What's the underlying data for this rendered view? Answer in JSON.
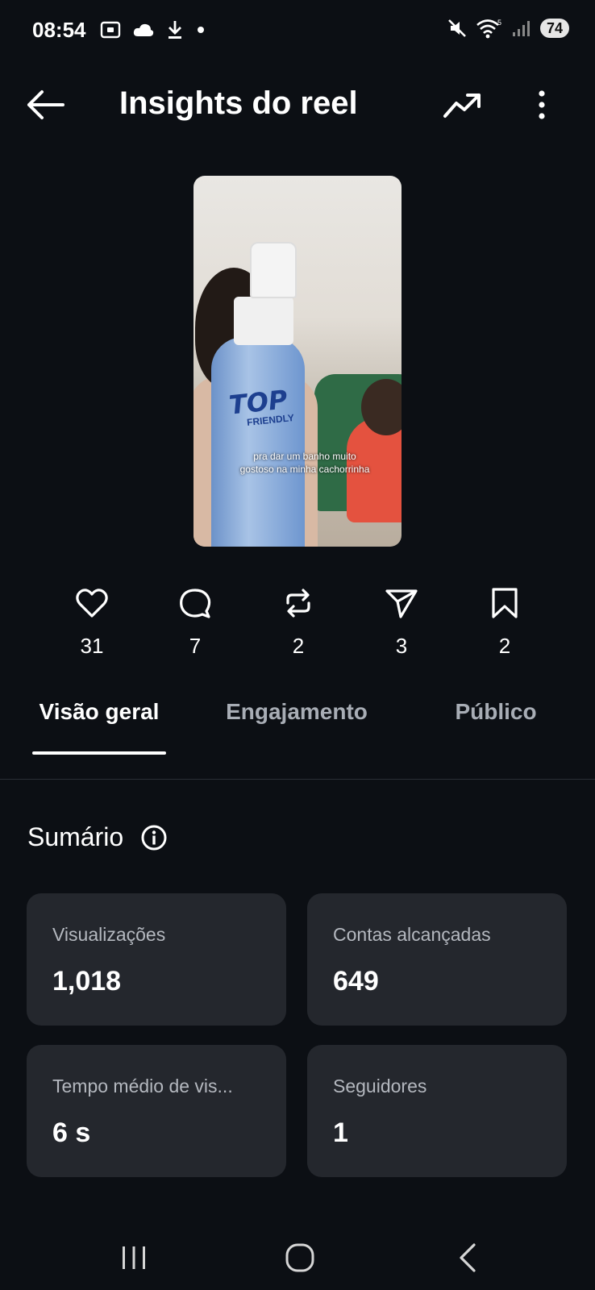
{
  "status_bar": {
    "time": "08:54",
    "battery": "74",
    "icons": [
      "screenshot-icon",
      "cloud-icon",
      "download-icon",
      "dot-icon",
      "mute-icon",
      "wifi-icon",
      "signal-icon",
      "battery-icon"
    ]
  },
  "header": {
    "title": "Insights do reel"
  },
  "video": {
    "caption_line1": "pra dar um banho muito",
    "caption_line2": "gostoso na minha cachorrinha",
    "logo_text": "TOP",
    "logo_sub": "FRIENDLY"
  },
  "metrics": {
    "likes": "31",
    "comments": "7",
    "reposts": "2",
    "shares": "3",
    "saves": "2"
  },
  "tabs": {
    "overview": "Visão geral",
    "engagement": "Engajamento",
    "audience": "Público"
  },
  "summary": {
    "title": "Sumário",
    "cards": [
      {
        "label": "Visualizações",
        "value": "1,018"
      },
      {
        "label": "Contas alcançadas",
        "value": "649"
      },
      {
        "label": "Tempo médio de vis...",
        "value": "6 s"
      },
      {
        "label": "Seguidores",
        "value": "1"
      }
    ]
  },
  "colors": {
    "background": "#0c0f14",
    "card": "#24272d",
    "tab_inactive": "#a8adb5"
  }
}
